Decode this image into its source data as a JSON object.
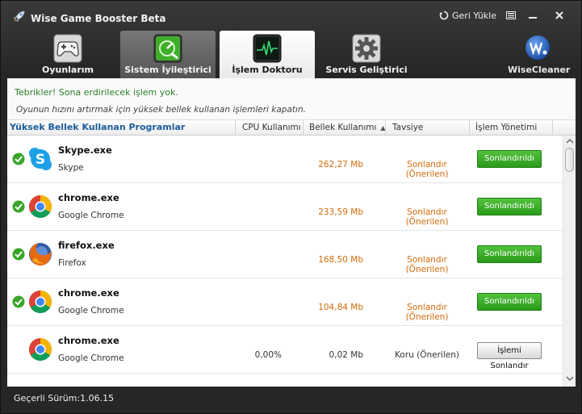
{
  "app": {
    "title": "Wise Game Booster Beta",
    "restore_label": "Geri Yükle",
    "brand": "WiseCleaner"
  },
  "tabs": [
    {
      "label": "Oyunlarım",
      "icon": "gamepad-icon"
    },
    {
      "label": "Sistem İyileştirici",
      "icon": "system-optimizer-icon"
    },
    {
      "label": "İşlem Doktoru",
      "icon": "heartbeat-monitor-icon"
    },
    {
      "label": "Servis Geliştirici",
      "icon": "gear-icon"
    }
  ],
  "info": {
    "success": "Tebrikler! Sona erdirilecek işlem yok.",
    "hint": "Oyunun hızını artırmak için yüksek bellek kullanan işlemleri kapatın."
  },
  "table": {
    "headers": {
      "program": "Yüksek Bellek Kullanan Programlar",
      "cpu": "CPU Kullanımı",
      "memory": "Bellek Kullanımı",
      "advice": "Tavsiye",
      "action": "İşlem Yönetimi"
    },
    "rows": [
      {
        "name": "Skype.exe",
        "desc": "Skype",
        "icon": "skype-icon",
        "cpu": "",
        "memory": "262,27 Mb",
        "advice": "Sonlandır (Önerilen)",
        "action": "Sonlandırıldı"
      },
      {
        "name": "chrome.exe",
        "desc": "Google Chrome",
        "icon": "chrome-icon",
        "cpu": "",
        "memory": "233,59 Mb",
        "advice": "Sonlandır (Önerilen)",
        "action": "Sonlandırıldı"
      },
      {
        "name": "firefox.exe",
        "desc": "Firefox",
        "icon": "firefox-icon",
        "cpu": "",
        "memory": "168,50 Mb",
        "advice": "Sonlandır (Önerilen)",
        "action": "Sonlandırıldı"
      },
      {
        "name": "chrome.exe",
        "desc": "Google Chrome",
        "icon": "chrome-icon",
        "cpu": "",
        "memory": "104,84 Mb",
        "advice": "Sonlandır (Önerilen)",
        "action": "Sonlandırıldı"
      },
      {
        "name": "chrome.exe",
        "desc": "Google Chrome",
        "icon": "chrome-icon",
        "cpu": "0,00%",
        "memory": "0,02 Mb",
        "advice": "Koru (Önerilen)",
        "action": "İşlemi Sonlandır"
      }
    ]
  },
  "status": {
    "version": "Geçerli Sürüm:1.06.15"
  },
  "colors": {
    "accent_green": "#2b9a1c",
    "warning_orange": "#d46a0a",
    "header_blue": "#1a5c9c"
  }
}
